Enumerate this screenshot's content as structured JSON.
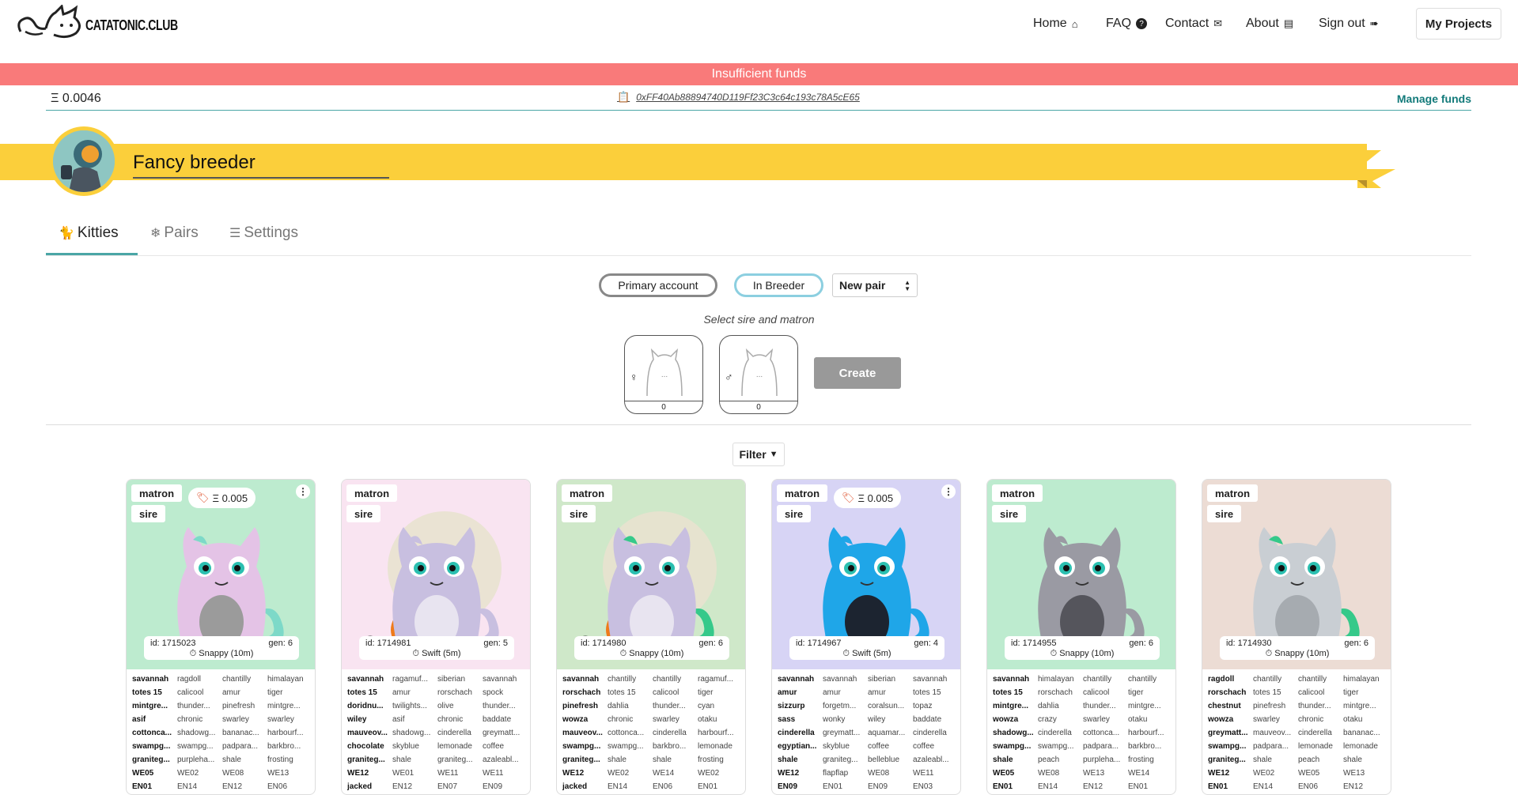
{
  "brand": {
    "name": "CATATONIC.CLUB"
  },
  "nav": [
    {
      "label": "Home",
      "icon": "home-icon"
    },
    {
      "label": "FAQ",
      "icon": "question-icon"
    },
    {
      "label": "Contact",
      "icon": "chat-icon"
    },
    {
      "label": "About",
      "icon": "book-icon"
    },
    {
      "label": "Sign out",
      "icon": "sign-out-icon"
    }
  ],
  "projects_button": "My Projects",
  "alert": "Insufficient funds",
  "account": {
    "balance": "Ξ 0.0046",
    "address": "0xFF40Ab88894740D119Ff23C3c64c193c78A5cE65",
    "manage": "Manage funds"
  },
  "breeder": {
    "name": "Fancy breeder"
  },
  "tabs": [
    {
      "label": "Kitties",
      "icon": "cat-icon",
      "active": true
    },
    {
      "label": "Pairs",
      "icon": "pair-icon",
      "active": false
    },
    {
      "label": "Settings",
      "icon": "sliders-icon",
      "active": false
    }
  ],
  "controls": {
    "primary_account": "Primary account",
    "in_breeder": "In Breeder",
    "pair_select": "New pair",
    "hint": "Select sire and matron",
    "matron_count": "0",
    "sire_count": "0",
    "create": "Create",
    "filter": "Filter"
  },
  "cards": [
    {
      "matron": "matron",
      "sire": "sire",
      "price": "Ξ 0.005",
      "has_price": true,
      "id": "id: 1715023",
      "gen": "gen: 6",
      "cooldown": "Snappy (10m)",
      "bg": "#bdebcf",
      "body": "#e4c3e6",
      "belly": "#9b9b9b",
      "accent": "#7dd9c8",
      "attrs": [
        [
          "savannah",
          "ragdoll",
          "chantilly",
          "himalayan"
        ],
        [
          "totes 15",
          "calicool",
          "amur",
          "tiger"
        ],
        [
          "mintgre...",
          "thunder...",
          "pinefresh",
          "mintgre..."
        ],
        [
          "asif",
          "chronic",
          "swarley",
          "swarley"
        ],
        [
          "cottonca...",
          "shadowg...",
          "bananac...",
          "harbourf..."
        ],
        [
          "swampg...",
          "swampg...",
          "padpara...",
          "barkbro..."
        ],
        [
          "graniteg...",
          "purpleha...",
          "shale",
          "frosting"
        ],
        [
          "WE05",
          "WE02",
          "WE08",
          "WE13"
        ],
        [
          "EN01",
          "EN14",
          "EN12",
          "EN06"
        ]
      ]
    },
    {
      "matron": "matron",
      "sire": "sire",
      "price": "",
      "has_price": false,
      "id": "id: 1714981",
      "gen": "gen: 5",
      "cooldown": "Swift (5m)",
      "bg": "#f9e4f1",
      "body": "#c8bfe0",
      "belly": "#e8e4f0",
      "accent": "#c8bfe0",
      "pumpkin": true,
      "attrs": [
        [
          "savannah",
          "ragamuf...",
          "siberian",
          "savannah"
        ],
        [
          "totes 15",
          "amur",
          "rorschach",
          "spock"
        ],
        [
          "doridnu...",
          "twilights...",
          "olive",
          "thunder..."
        ],
        [
          "wiley",
          "asif",
          "chronic",
          "baddate"
        ],
        [
          "mauveov...",
          "shadowg...",
          "cinderella",
          "greymatt..."
        ],
        [
          "chocolate",
          "skyblue",
          "lemonade",
          "coffee"
        ],
        [
          "graniteg...",
          "shale",
          "graniteg...",
          "azaleabl..."
        ],
        [
          "WE12",
          "WE01",
          "WE11",
          "WE11"
        ],
        [
          "jacked",
          "EN12",
          "EN07",
          "EN09"
        ]
      ]
    },
    {
      "matron": "matron",
      "sire": "sire",
      "price": "",
      "has_price": false,
      "id": "id: 1714980",
      "gen": "gen: 6",
      "cooldown": "Snappy (10m)",
      "bg": "#cfe8c9",
      "body": "#c8bfe0",
      "belly": "#e8e4f0",
      "accent": "#35c98a",
      "pumpkin": true,
      "attrs": [
        [
          "savannah",
          "chantilly",
          "chantilly",
          "ragamuf..."
        ],
        [
          "rorschach",
          "totes 15",
          "calicool",
          "tiger"
        ],
        [
          "pinefresh",
          "dahlia",
          "thunder...",
          "cyan"
        ],
        [
          "wowza",
          "chronic",
          "swarley",
          "otaku"
        ],
        [
          "mauveov...",
          "cottonca...",
          "cinderella",
          "harbourf..."
        ],
        [
          "swampg...",
          "swampg...",
          "barkbro...",
          "lemonade"
        ],
        [
          "graniteg...",
          "shale",
          "shale",
          "frosting"
        ],
        [
          "WE12",
          "WE02",
          "WE14",
          "WE02"
        ],
        [
          "jacked",
          "EN14",
          "EN06",
          "EN01"
        ]
      ]
    },
    {
      "matron": "matron",
      "sire": "sire",
      "price": "Ξ 0.005",
      "has_price": true,
      "id": "id: 1714967",
      "gen": "gen: 4",
      "cooldown": "Swift (5m)",
      "bg": "#d7d4f5",
      "body": "#1fa6e8",
      "belly": "#1c2430",
      "accent": "#1fa6e8",
      "attrs": [
        [
          "savannah",
          "savannah",
          "siberian",
          "savannah"
        ],
        [
          "amur",
          "amur",
          "amur",
          "totes 15"
        ],
        [
          "sizzurp",
          "forgetm...",
          "coralsun...",
          "topaz"
        ],
        [
          "sass",
          "wonky",
          "wiley",
          "baddate"
        ],
        [
          "cinderella",
          "greymatt...",
          "aquamar...",
          "cinderella"
        ],
        [
          "egyptian...",
          "skyblue",
          "coffee",
          "coffee"
        ],
        [
          "shale",
          "graniteg...",
          "belleblue",
          "azaleabl..."
        ],
        [
          "WE12",
          "flapflap",
          "WE08",
          "WE11"
        ],
        [
          "EN09",
          "EN01",
          "EN09",
          "EN03"
        ]
      ]
    },
    {
      "matron": "matron",
      "sire": "sire",
      "price": "",
      "has_price": false,
      "id": "id: 1714955",
      "gen": "gen: 6",
      "cooldown": "Snappy (10m)",
      "bg": "#bdebcf",
      "body": "#9a9aa3",
      "belly": "#55555c",
      "accent": "#9a9aa3",
      "attrs": [
        [
          "savannah",
          "himalayan",
          "chantilly",
          "chantilly"
        ],
        [
          "totes 15",
          "rorschach",
          "calicool",
          "tiger"
        ],
        [
          "mintgre...",
          "dahlia",
          "thunder...",
          "mintgre..."
        ],
        [
          "wowza",
          "crazy",
          "swarley",
          "otaku"
        ],
        [
          "shadowg...",
          "cinderella",
          "cottonca...",
          "harbourf..."
        ],
        [
          "swampg...",
          "swampg...",
          "padpara...",
          "barkbro..."
        ],
        [
          "shale",
          "peach",
          "purpleha...",
          "frosting"
        ],
        [
          "WE05",
          "WE08",
          "WE13",
          "WE14"
        ],
        [
          "EN01",
          "EN14",
          "EN12",
          "EN01"
        ]
      ]
    },
    {
      "matron": "matron",
      "sire": "sire",
      "price": "",
      "has_price": false,
      "id": "id: 1714930",
      "gen": "gen: 6",
      "cooldown": "Snappy (10m)",
      "bg": "#ecdcd4",
      "body": "#c9ced3",
      "belly": "#a6abb0",
      "accent": "#35c98a",
      "attrs": [
        [
          "ragdoll",
          "chantilly",
          "chantilly",
          "himalayan"
        ],
        [
          "rorschach",
          "totes 15",
          "calicool",
          "tiger"
        ],
        [
          "chestnut",
          "pinefresh",
          "thunder...",
          "mintgre..."
        ],
        [
          "wowza",
          "swarley",
          "chronic",
          "otaku"
        ],
        [
          "greymatt...",
          "mauveov...",
          "cinderella",
          "bananac..."
        ],
        [
          "swampg...",
          "padpara...",
          "lemonade",
          "lemonade"
        ],
        [
          "graniteg...",
          "shale",
          "peach",
          "shale"
        ],
        [
          "WE12",
          "WE02",
          "WE05",
          "WE13"
        ],
        [
          "EN01",
          "EN14",
          "EN06",
          "EN12"
        ]
      ]
    }
  ]
}
